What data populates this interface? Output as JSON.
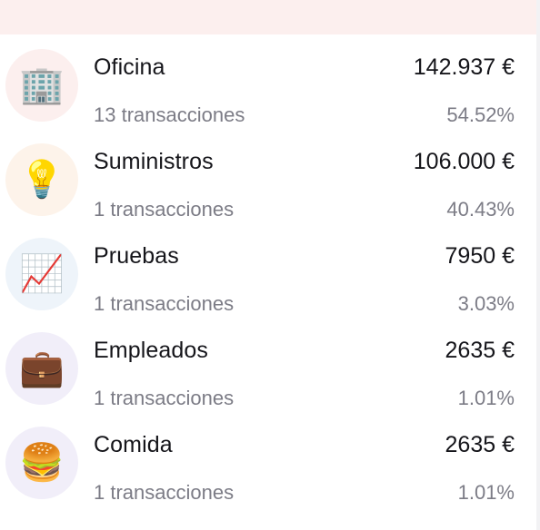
{
  "categories": [
    {
      "icon": "office-building-icon",
      "emoji": "🏢",
      "bg": "#fcefee",
      "name": "Oficina",
      "amount": "142.937 €",
      "count": "13 transacciones",
      "percent": "54.52%"
    },
    {
      "icon": "light-bulb-icon",
      "emoji": "💡",
      "bg": "#fdf3ea",
      "name": "Suministros",
      "amount": "106.000 €",
      "count": "1 transacciones",
      "percent": "40.43%"
    },
    {
      "icon": "trend-chart-icon",
      "emoji": "📈",
      "bg": "#eef4fa",
      "name": "Pruebas",
      "amount": "7950 €",
      "count": "1 transacciones",
      "percent": "3.03%"
    },
    {
      "icon": "briefcase-icon",
      "emoji": "💼",
      "bg": "#f1eef9",
      "name": "Empleados",
      "amount": "2635 €",
      "count": "1 transacciones",
      "percent": "1.01%"
    },
    {
      "icon": "burger-icon",
      "emoji": "🍔",
      "bg": "#f1eef9",
      "name": "Comida",
      "amount": "2635 €",
      "count": "1 transacciones",
      "percent": "1.01%"
    }
  ]
}
